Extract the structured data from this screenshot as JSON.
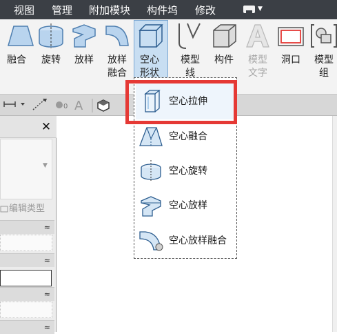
{
  "menubar": {
    "items": [
      "视图",
      "管理",
      "附加模块",
      "构件坞",
      "修改"
    ],
    "toggle_icon": "ribbon-toggle-icon"
  },
  "ribbon": {
    "tools": [
      {
        "label": "融合",
        "icon": "blend-icon",
        "disabled": false
      },
      {
        "label": "旋转",
        "icon": "revolve-icon",
        "disabled": false
      },
      {
        "label": "放样",
        "icon": "sweep-icon",
        "disabled": false
      },
      {
        "label": "放样\n融合",
        "icon": "swept-blend-icon",
        "disabled": false
      },
      {
        "label": "空心\n形状",
        "icon": "void-forms-icon",
        "disabled": false,
        "active": true
      },
      {
        "label": "模型\n线",
        "icon": "model-line-icon",
        "disabled": false
      },
      {
        "label": "构件",
        "icon": "component-icon",
        "disabled": false
      },
      {
        "label": "模型\n文字",
        "icon": "model-text-icon",
        "disabled": true
      },
      {
        "label": "洞口",
        "icon": "opening-icon",
        "disabled": false
      },
      {
        "label": "模型\n组",
        "icon": "model-group-icon",
        "disabled": false
      }
    ]
  },
  "panel": {
    "close_glyph": "✕",
    "edit_type_label": "编辑类型",
    "collapse_glyph": "≈"
  },
  "dropdown": {
    "items": [
      {
        "label": "空心拉伸",
        "icon": "void-extrusion-icon"
      },
      {
        "label": "空心融合",
        "icon": "void-blend-icon"
      },
      {
        "label": "空心旋转",
        "icon": "void-revolve-icon"
      },
      {
        "label": "空心放样",
        "icon": "void-sweep-icon"
      },
      {
        "label": "空心放样融合",
        "icon": "void-swept-blend-icon"
      }
    ]
  },
  "colors": {
    "menubar_bg": "#3b3f45",
    "highlight": "#e53935",
    "active_tool_bg": "#c8def2",
    "icon_blue": "#6fa8dc"
  }
}
